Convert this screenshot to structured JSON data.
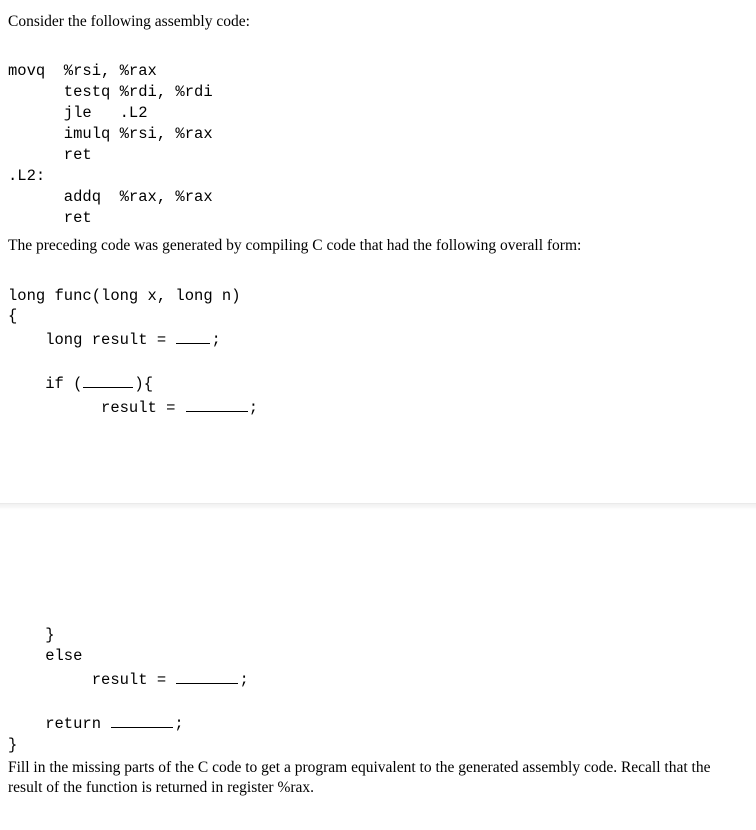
{
  "intro": "Consider the following assembly code:",
  "asm": {
    "l1": "movq  %rsi, %rax",
    "l2": "      testq %rdi, %rdi",
    "l3": "      jle   .L2",
    "l4": "      imulq %rsi, %rax",
    "l5": "      ret",
    "l6": ".L2:",
    "l7": "      addq  %rax, %rax",
    "l8": "      ret"
  },
  "mid": "The preceding code was generated by compiling C code that had the following overall form:",
  "c": {
    "sig": "long func(long x, long n)",
    "open": "{",
    "res_decl_pre": "    long result = ",
    "semi": ";",
    "if_pre": "    if (",
    "if_post": "){",
    "res_eq_indent": "          result = ",
    "brace_close_indent": "    }",
    "else_line": "    else",
    "res_eq_indent2": "         result = ",
    "return_pre": "    return ",
    "close": "}"
  },
  "footer": "Fill in the missing parts of the C code to get a program equivalent to the generated assembly code. Recall that the result of the function is returned in register %rax."
}
